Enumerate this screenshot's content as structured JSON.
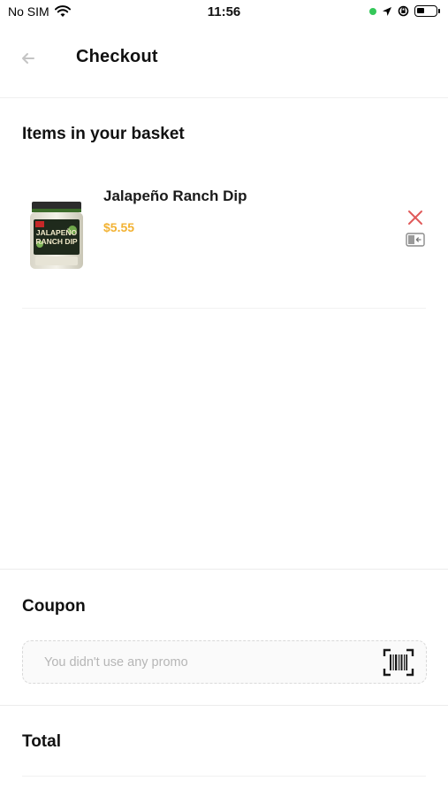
{
  "status_bar": {
    "carrier": "No SIM",
    "time": "11:56"
  },
  "header": {
    "title": "Checkout"
  },
  "basket": {
    "title": "Items in your basket",
    "items": [
      {
        "name": "Jalapeño Ranch Dip",
        "price": "$5.55",
        "image_label_line1": "JALAPEÑO",
        "image_label_line2": "RANCH DIP"
      }
    ]
  },
  "coupon": {
    "title": "Coupon",
    "value": "",
    "placeholder": "You didn't use any promo"
  },
  "total": {
    "title": "Total"
  },
  "colors": {
    "price": "#f2b233",
    "remove": "#e05a5a",
    "status_green": "#34c759"
  },
  "icons": {
    "back": "arrow-left-icon",
    "wifi": "wifi-icon",
    "location": "location-arrow-icon",
    "lock_rotation": "orientation-lock-icon",
    "battery": "battery-icon",
    "remove": "close-icon",
    "detail": "panel-icon",
    "barcode": "barcode-scan-icon"
  }
}
